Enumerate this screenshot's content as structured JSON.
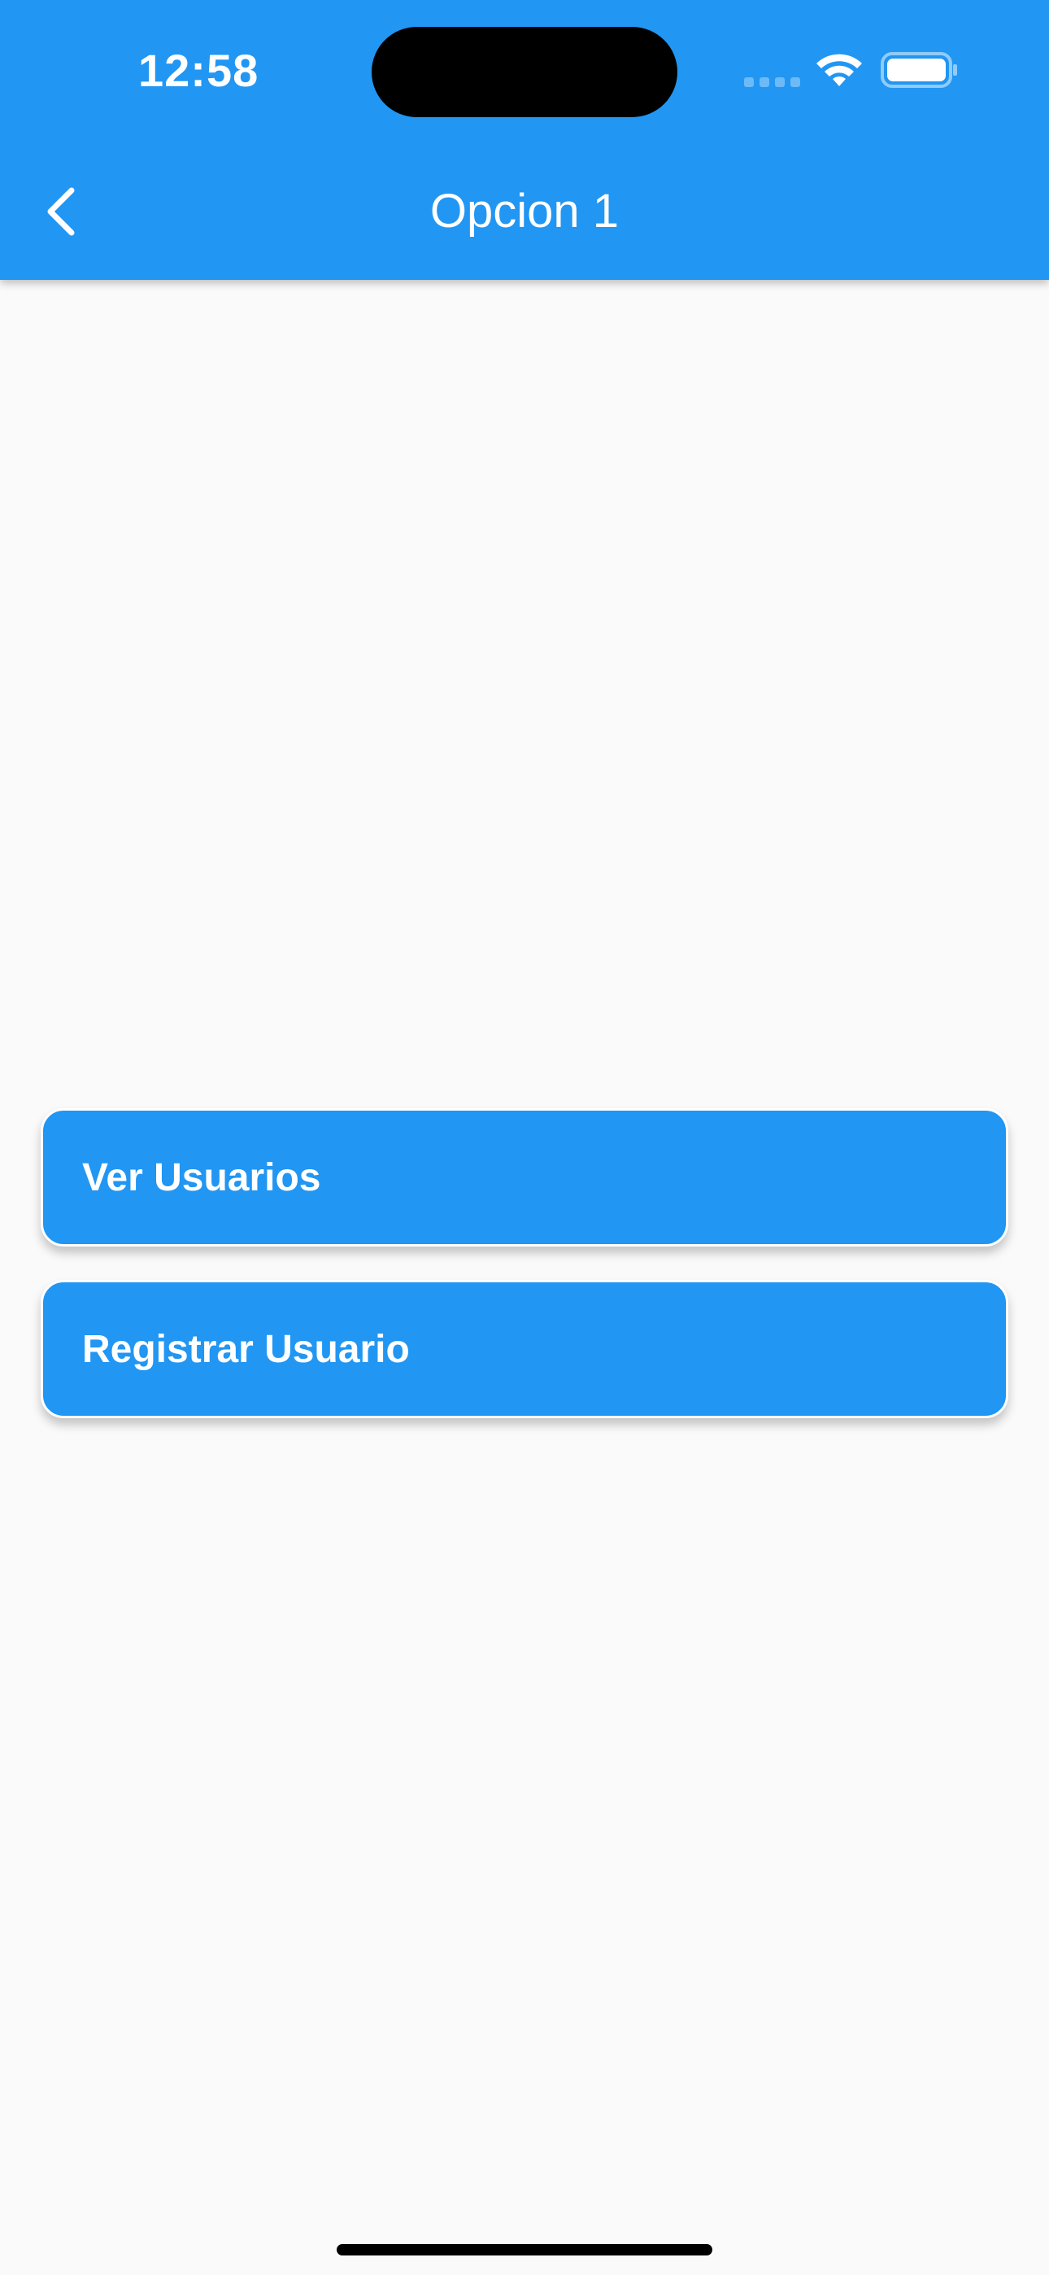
{
  "status_bar": {
    "time": "12:58",
    "icons": [
      "signal-icon",
      "wifi-icon",
      "battery-icon"
    ]
  },
  "app_bar": {
    "title": "Opcion 1",
    "back_icon": "chevron-left-icon",
    "color": "#2196F3"
  },
  "menu": {
    "items": [
      {
        "label": "Ver Usuarios"
      },
      {
        "label": "Registrar Usuario"
      }
    ],
    "button_color": "#2196F3"
  },
  "colors": {
    "background": "#FAFAFA",
    "accent": "#2196F3",
    "text_on_accent": "#FFFFFF"
  }
}
